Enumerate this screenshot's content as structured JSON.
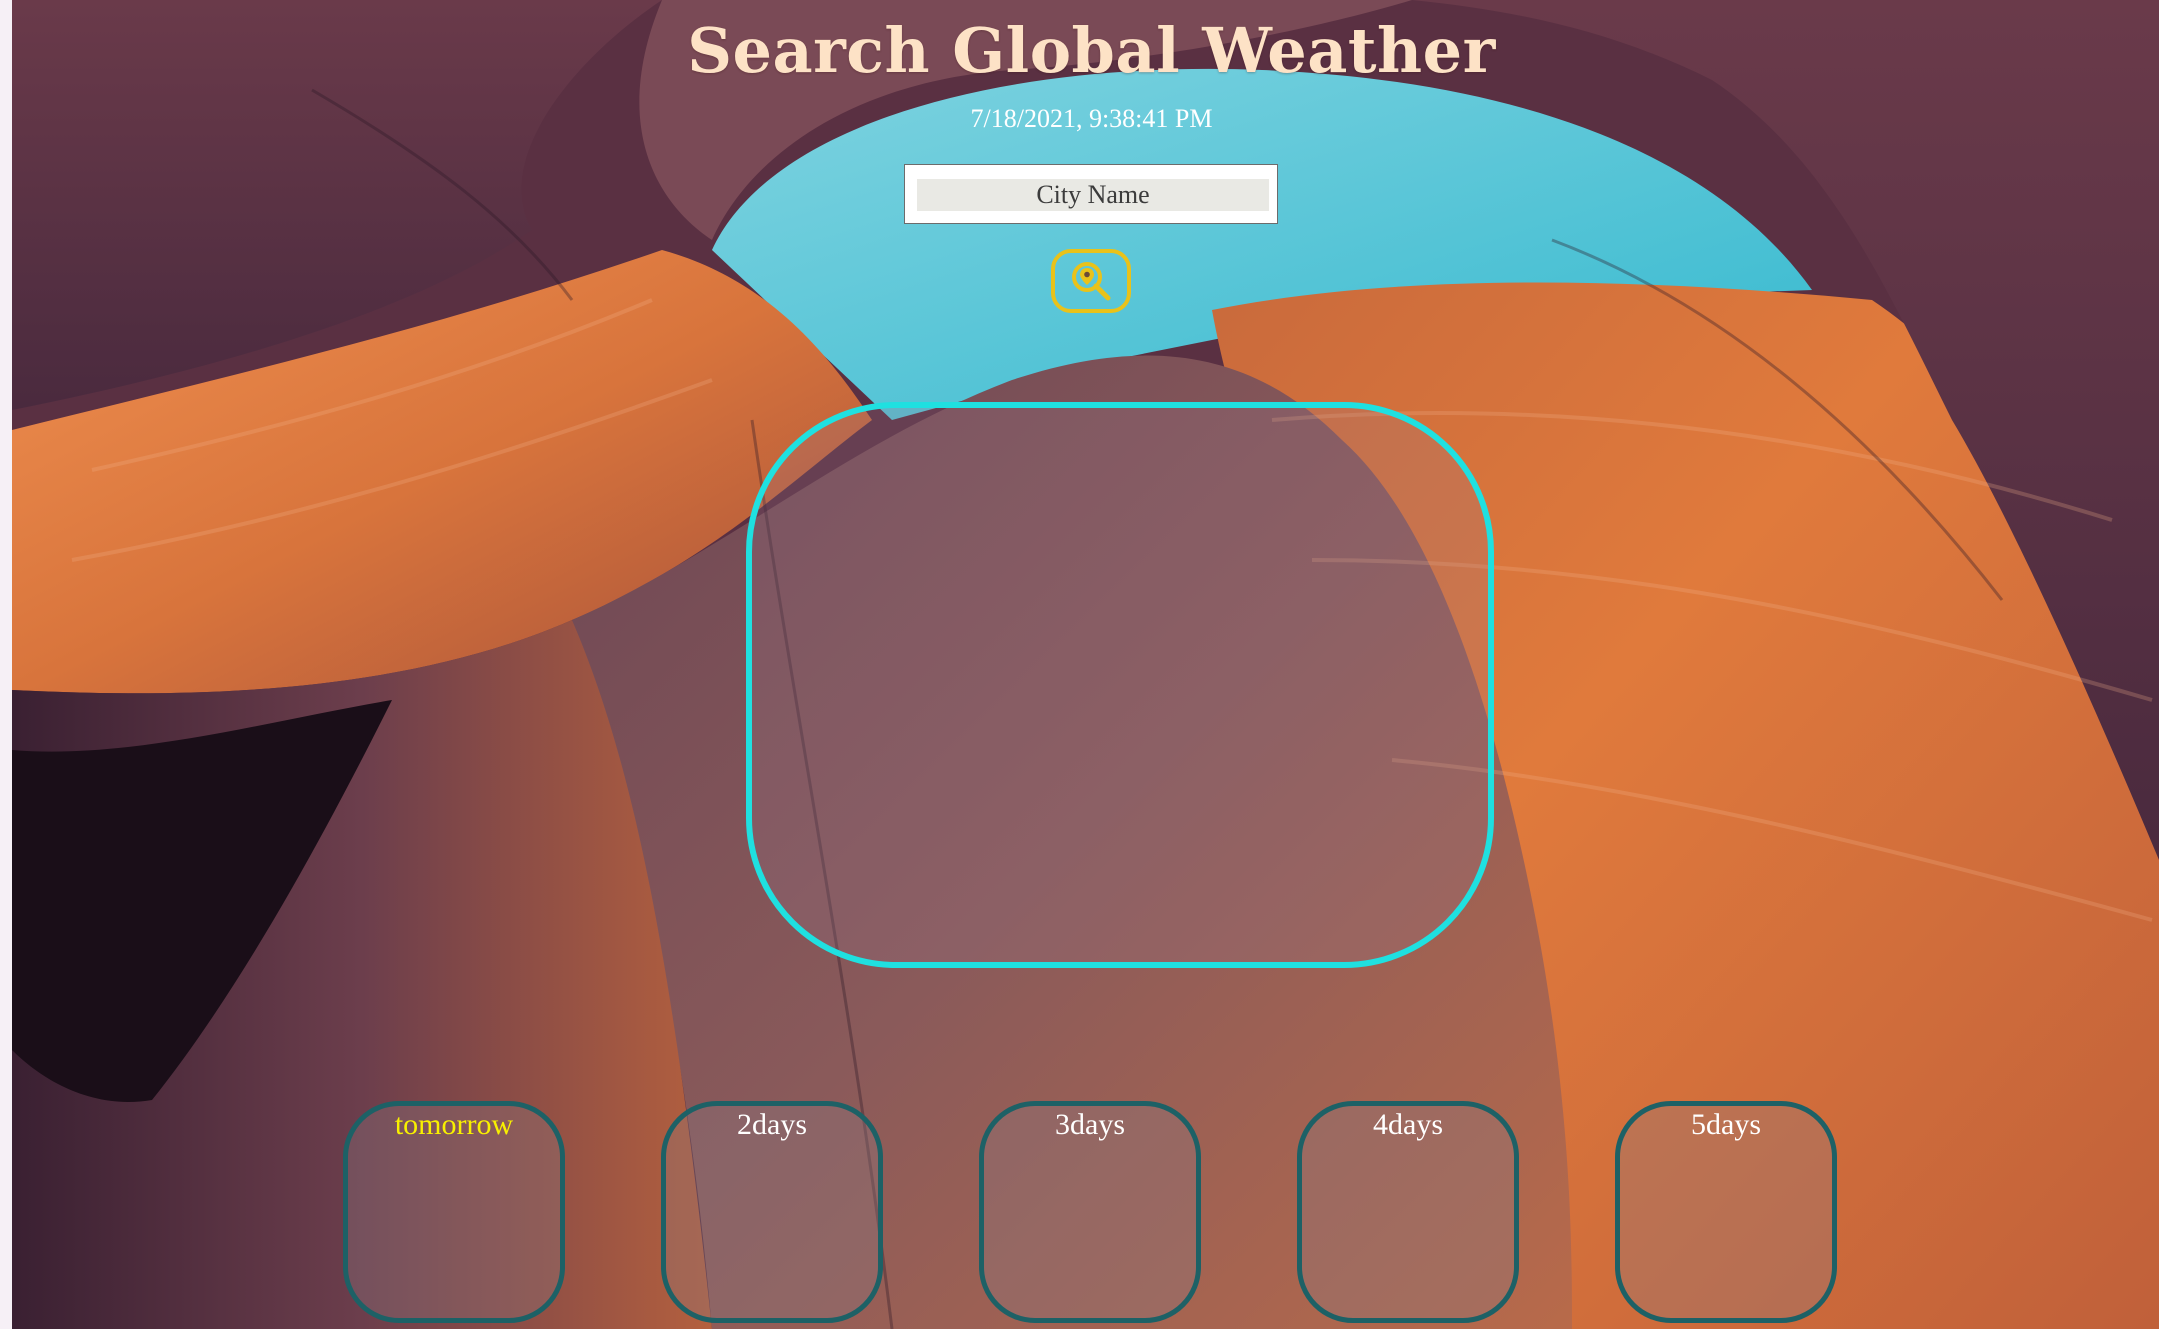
{
  "header": {
    "title": "Search Global Weather",
    "datetime": "7/18/2021, 9:38:41 PM"
  },
  "search": {
    "placeholder": "City Name",
    "button_icon": "search-location-icon"
  },
  "forecast": [
    {
      "label": "tomorrow",
      "highlighted": true
    },
    {
      "label": "2days",
      "highlighted": false
    },
    {
      "label": "3days",
      "highlighted": false
    },
    {
      "label": "4days",
      "highlighted": false
    },
    {
      "label": "5days",
      "highlighted": false
    }
  ],
  "colors": {
    "title": "#fde2c6",
    "search_button_border": "#e9c21a",
    "main_card_border": "#1fe0e0",
    "forecast_card_border": "#1d6166",
    "highlight_label": "#f8f000"
  }
}
